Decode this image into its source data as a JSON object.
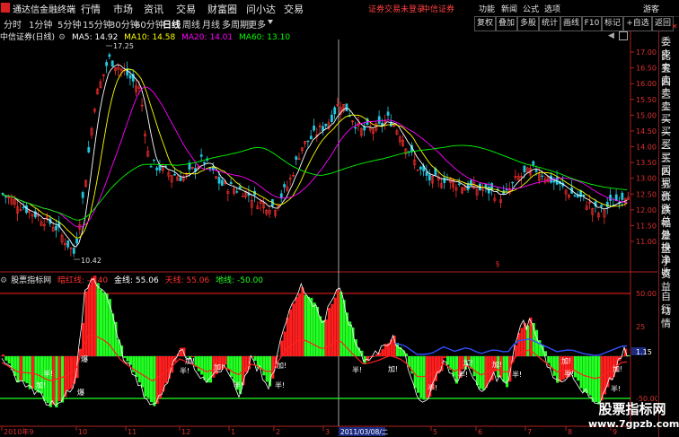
{
  "app": {
    "title": "通达信金融终端",
    "menu": [
      "行情",
      "市场",
      "资讯",
      "交易",
      "财富圈",
      "问小达",
      "交易"
    ],
    "login_notice": "证券交易未登录",
    "broker": "中信证券",
    "right_menu": [
      "功能",
      "新闻",
      "公式",
      "选项",
      "游客"
    ]
  },
  "periods": {
    "items": [
      "分时",
      "1分钟",
      "5分钟",
      "15分钟",
      "30分钟",
      "60分钟",
      "日线",
      "周线",
      "月线",
      "多周期",
      "更多"
    ],
    "active": "日线"
  },
  "toolbar": {
    "items": [
      "复权",
      "叠加",
      "多股",
      "统计",
      "画线",
      "F10",
      "标记",
      "+自选",
      "返回"
    ]
  },
  "side_panel": {
    "items": [
      "委比",
      "卖五",
      "卖四",
      "卖三",
      "卖二",
      "卖一",
      "买一",
      "买二",
      "买三",
      "买四",
      "买五",
      "现价",
      "涨跌",
      "涨幅",
      "总量",
      "外盘",
      "换手",
      "净资",
      "收益",
      "自动",
      "行情"
    ]
  },
  "main_chart": {
    "name_label": "中信证券(日线)",
    "ma5": "MA5: 14.92",
    "ma10": "MA10: 14.58",
    "ma20": "MA20: 14.01",
    "ma60": "MA60: 13.10",
    "high_label": "17.25",
    "low_label": "10.42",
    "y_ticks": [
      "17.00",
      "16.50",
      "16.00",
      "15.50",
      "15.00",
      "14.50",
      "14.00",
      "13.50",
      "13.00",
      "12.50",
      "12.00",
      "11.50",
      "11.00"
    ]
  },
  "indicator": {
    "title": "股票指标网",
    "dark_line": "暗红线: -6.40",
    "gold_line": "金线: 55.06",
    "sky_line": "天线: 55.06",
    "ground_line": "地线: -50.00",
    "y_ticks": [
      "50.00",
      "25",
      "1.15",
      "-50.00"
    ],
    "marks": [
      "加!",
      "半!",
      "爆"
    ]
  },
  "x_axis": {
    "labels": [
      "2010年9",
      "10",
      "11",
      "12",
      "1",
      "2",
      "3",
      "4",
      "5",
      "6",
      "7",
      "8",
      "9"
    ],
    "cursor_date": "2011/03/08/二"
  },
  "watermark": {
    "line1": "股票指标网",
    "line2": "www.7gpzb.com"
  },
  "colors": {
    "up": "#ff3030",
    "down": "#22c8e0",
    "ma5": "#ffffff",
    "ma10": "#ffff00",
    "ma20": "#ff00ff",
    "ma60": "#00ff00",
    "axis": "#b02020",
    "bar_red": "#ff1e1e",
    "bar_green": "#22ff22"
  }
}
